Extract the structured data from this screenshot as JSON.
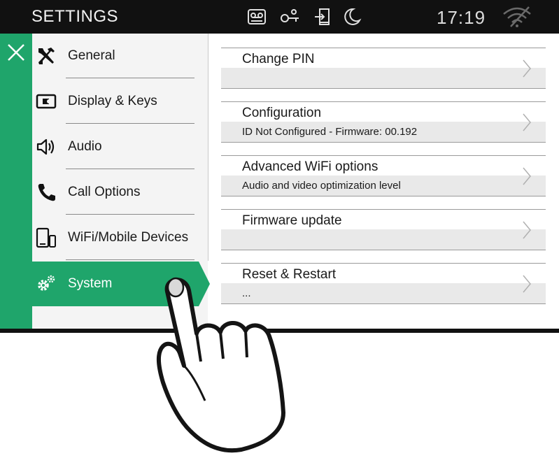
{
  "header": {
    "title": "SETTINGS",
    "time": "17:19",
    "status_icons": [
      "voicemail-icon",
      "key-access-icon",
      "door-entry-icon",
      "moon-icon",
      "wifi-off-icon"
    ]
  },
  "colors": {
    "accent": "#1fa56b",
    "topbar": "#111111",
    "sidebar_bg": "#f4f4f4",
    "row_sub_bg": "#e9e9e9"
  },
  "sidebar": {
    "items": [
      {
        "label": "General",
        "icon": "wrench-screwdriver-icon",
        "active": false
      },
      {
        "label": "Display & Keys",
        "icon": "display-icon",
        "active": false
      },
      {
        "label": "Audio",
        "icon": "speaker-icon",
        "active": false
      },
      {
        "label": "Call Options",
        "icon": "phone-icon",
        "active": false
      },
      {
        "label": "WiFi/Mobile Devices",
        "icon": "devices-icon",
        "active": false
      },
      {
        "label": "System",
        "icon": "gears-icon",
        "active": true
      }
    ]
  },
  "main": {
    "rows": [
      {
        "title": "Change PIN",
        "subtitle": ""
      },
      {
        "title": "Configuration",
        "subtitle": "ID Not Configured - Firmware: 00.192"
      },
      {
        "title": "Advanced WiFi options",
        "subtitle": "Audio and video optimization level"
      },
      {
        "title": "Firmware update",
        "subtitle": ""
      },
      {
        "title": "Reset & Restart",
        "subtitle": "..."
      }
    ]
  }
}
